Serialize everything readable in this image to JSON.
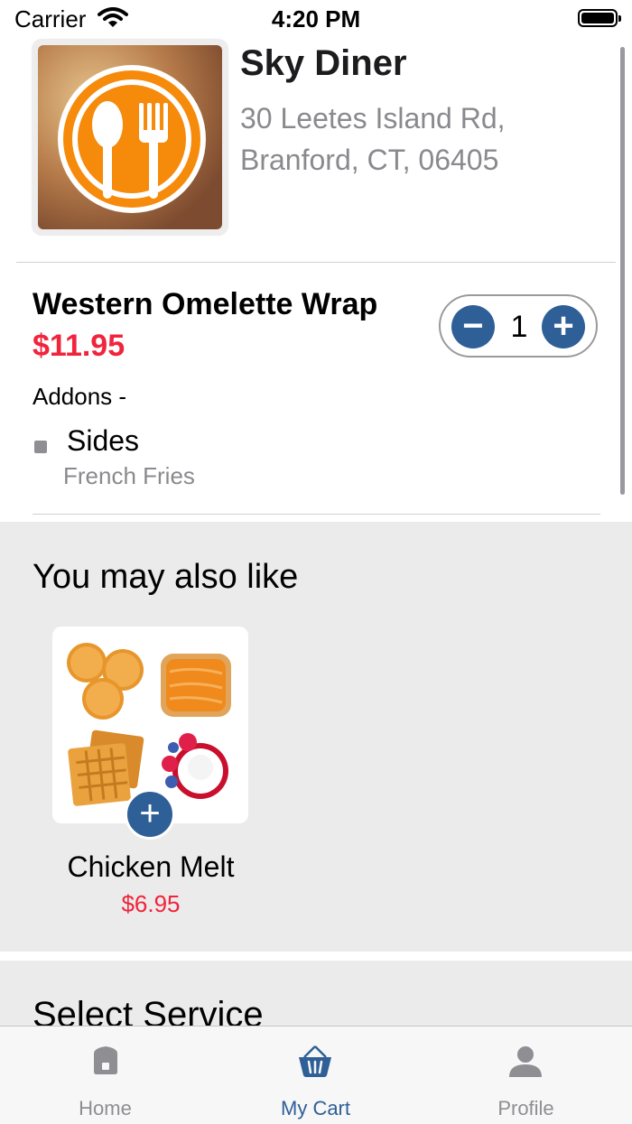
{
  "status_bar": {
    "carrier": "Carrier",
    "time": "4:20 PM"
  },
  "restaurant": {
    "name": "Sky Diner",
    "address": "30 Leetes Island Rd, Branford, CT, 06405"
  },
  "cart_item": {
    "name": "Western Omelette Wrap",
    "price": "$11.95",
    "quantity": "1",
    "addons_label": "Addons -",
    "addon_group": "Sides",
    "addon_choice": "French Fries"
  },
  "suggestions": {
    "title": "You may also like",
    "items": [
      {
        "name": "Chicken Melt",
        "price": "$6.95"
      }
    ]
  },
  "service": {
    "title": "Select Service"
  },
  "tab_bar": {
    "items": [
      {
        "label": "Home",
        "icon": "home-icon",
        "active": false
      },
      {
        "label": "My Cart",
        "icon": "basket-icon",
        "active": true
      },
      {
        "label": "Profile",
        "icon": "person-icon",
        "active": false
      }
    ]
  },
  "colors": {
    "accent": "#2F5F97",
    "price": "#F0243C",
    "secondary_text": "#8A8A8E",
    "section_bg": "#EBEBEB"
  }
}
